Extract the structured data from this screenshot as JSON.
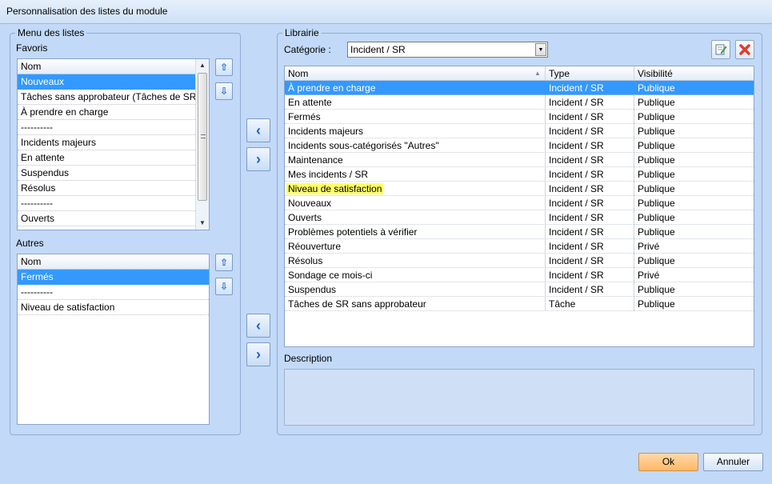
{
  "window": {
    "title": "Personnalisation des listes du module"
  },
  "menu_group": {
    "title": "Menu des listes",
    "favoris_label": "Favoris",
    "autres_label": "Autres",
    "column_header": "Nom",
    "favoris": [
      "Nouveaux",
      "Tâches sans approbateur (Tâches de SR…",
      "À prendre en charge",
      "----------",
      "Incidents majeurs",
      "En attente",
      "Suspendus",
      "Résolus",
      "----------",
      "Ouverts"
    ],
    "autres": [
      "Fermés",
      "----------",
      "Niveau de satisfaction"
    ]
  },
  "library": {
    "title": "Librairie",
    "category_label": "Catégorie :",
    "category_value": "Incident / SR",
    "columns": {
      "name": "Nom",
      "type": "Type",
      "visibility": "Visibilité"
    },
    "rows": [
      {
        "name": "À prendre en charge",
        "type": "Incident / SR",
        "visibility": "Publique"
      },
      {
        "name": "En attente",
        "type": "Incident / SR",
        "visibility": "Publique"
      },
      {
        "name": "Fermés",
        "type": "Incident / SR",
        "visibility": "Publique"
      },
      {
        "name": "Incidents majeurs",
        "type": "Incident / SR",
        "visibility": "Publique"
      },
      {
        "name": "Incidents sous-catégorisés \"Autres\"",
        "type": "Incident / SR",
        "visibility": "Publique"
      },
      {
        "name": "Maintenance",
        "type": "Incident / SR",
        "visibility": "Publique"
      },
      {
        "name": "Mes incidents / SR",
        "type": "Incident / SR",
        "visibility": "Publique"
      },
      {
        "name": "Niveau de satisfaction",
        "type": "Incident / SR",
        "visibility": "Publique"
      },
      {
        "name": "Nouveaux",
        "type": "Incident / SR",
        "visibility": "Publique"
      },
      {
        "name": "Ouverts",
        "type": "Incident / SR",
        "visibility": "Publique"
      },
      {
        "name": "Problèmes potentiels à vérifier",
        "type": "Incident / SR",
        "visibility": "Publique"
      },
      {
        "name": "Réouverture",
        "type": "Incident / SR",
        "visibility": "Privé"
      },
      {
        "name": "Résolus",
        "type": "Incident / SR",
        "visibility": "Publique"
      },
      {
        "name": "Sondage ce mois-ci",
        "type": "Incident / SR",
        "visibility": "Privé"
      },
      {
        "name": "Suspendus",
        "type": "Incident / SR",
        "visibility": "Publique"
      },
      {
        "name": "Tâches de SR sans approbateur",
        "type": "Tâche",
        "visibility": "Publique"
      }
    ],
    "description_label": "Description"
  },
  "icons": {
    "move_up": "arrow-up-icon",
    "move_down": "arrow-down-icon",
    "move_left": "chevron-left-icon",
    "move_right": "chevron-right-icon",
    "edit": "edit-note-icon",
    "delete": "delete-x-icon"
  },
  "colors": {
    "selection": "#3399ff",
    "highlight": "#ffff66",
    "ok_button": "#ffb866"
  },
  "buttons": {
    "ok": "Ok",
    "cancel": "Annuler"
  }
}
